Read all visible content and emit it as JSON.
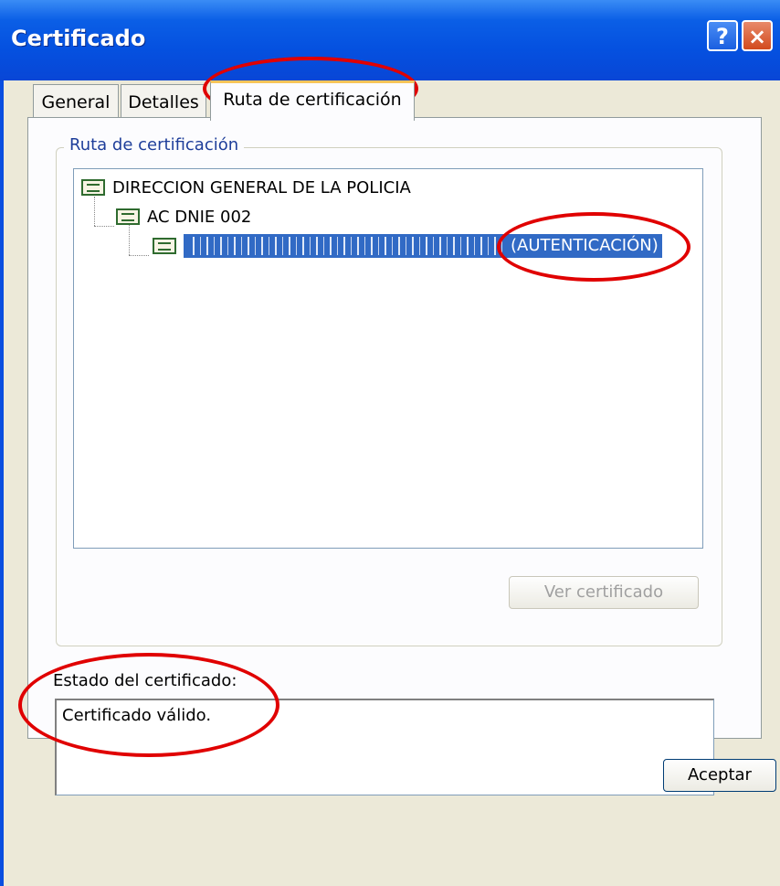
{
  "window": {
    "title": "Certificado",
    "help_button": "?",
    "close_button": "×"
  },
  "tabs": [
    {
      "label": "General"
    },
    {
      "label": "Detalles"
    },
    {
      "label": "Ruta de certificación",
      "active": true
    }
  ],
  "path_group": {
    "label": "Ruta de certificación"
  },
  "tree": [
    {
      "label": "DIRECCION GENERAL DE LA POLICIA",
      "icon": "certificate-icon"
    },
    {
      "label": "AC DNIE 002",
      "icon": "certificate-icon"
    },
    {
      "label": "(AUTENTICACIÓN)",
      "icon": "certificate-icon",
      "selected": true,
      "redacted_prefix": true
    }
  ],
  "buttons": {
    "view_certificate": "Ver certificado",
    "accept": "Aceptar"
  },
  "status": {
    "label": "Estado del certificado:",
    "text": "Certificado válido."
  },
  "colors": {
    "annotation": "#e00000",
    "selection": "#316ac5",
    "titlebar": "#0551e0"
  }
}
